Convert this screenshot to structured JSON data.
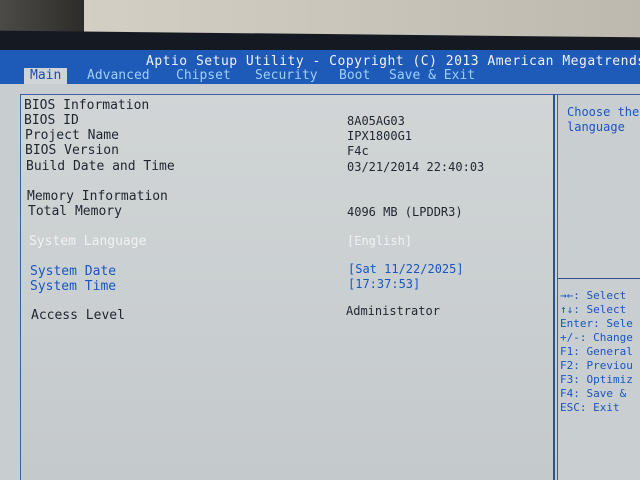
{
  "window": {
    "title": "Aptio Setup Utility - Copyright (C) 2013 American Megatrends"
  },
  "tabs": [
    {
      "label": "Main",
      "active": true
    },
    {
      "label": "Advanced",
      "active": false
    },
    {
      "label": "Chipset",
      "active": false
    },
    {
      "label": "Security",
      "active": false
    },
    {
      "label": "Boot",
      "active": false
    },
    {
      "label": "Save & Exit",
      "active": false
    }
  ],
  "main": {
    "bios_info": {
      "heading": "BIOS Information",
      "bios_id_label": "BIOS ID",
      "bios_id_value": "8A05AG03",
      "project_label": "Project Name",
      "project_value": "IPX1800G1",
      "version_label": "BIOS Version",
      "version_value": "F4c",
      "build_label": "Build Date and Time",
      "build_value": "03/21/2014 22:40:03"
    },
    "memory_info": {
      "heading": "Memory Information",
      "total_label": "Total Memory",
      "total_value": "4096 MB (LPDDR3)"
    },
    "language": {
      "label": "System Language",
      "value": "[English]"
    },
    "date": {
      "label": "System Date",
      "value": "[Sat 11/22/2025]"
    },
    "time": {
      "label": "System Time",
      "value": "[17:37:53]"
    },
    "access": {
      "label": "Access Level",
      "value": "Administrator"
    }
  },
  "help": {
    "line1": "Choose the",
    "line2": "language",
    "keys": [
      "→←: Select",
      "↑↓: Select",
      "Enter: Sele",
      "+/-: Change",
      "F1: General",
      "F2: Previou",
      "F3: Optimiz",
      "F4: Save &",
      "ESC: Exit"
    ]
  },
  "colors": {
    "title_bar": "#1e5ab8",
    "screen_bg": "#c8cdd0",
    "accent_text": "#1a55c0"
  }
}
